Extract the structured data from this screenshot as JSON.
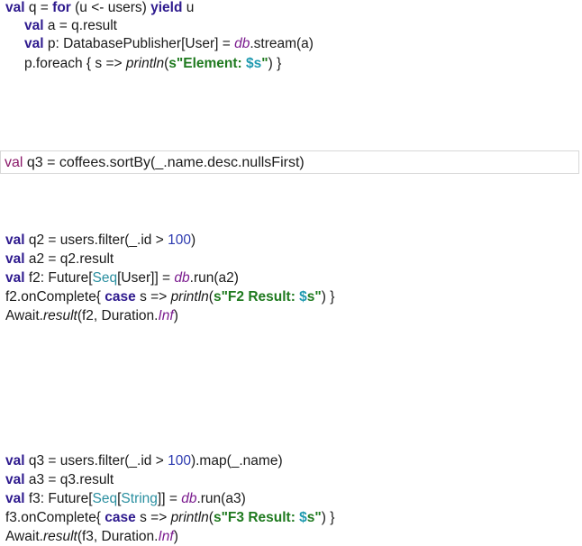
{
  "snippet1": {
    "l1": {
      "a": "val",
      "b": " q = ",
      "c": "for",
      "d": " (u <- users) ",
      "e": "yield",
      "f": " u"
    },
    "l2": {
      "a": "val",
      "b": " a = q.result"
    },
    "l3": {
      "a": "val",
      "b": " p: DatabasePublisher[User] = ",
      "c": "db",
      "d": ".stream(a)"
    },
    "l4": {
      "a": "p.foreach { s => ",
      "b": "println",
      "c": "(",
      "d": "s\"Element: ",
      "e": "$s",
      "f": "\"",
      "g": ") }"
    }
  },
  "snippet2": {
    "l1": {
      "a": "val",
      "b": " q3 = coffees.sortBy(_.name.desc.nullsFirst)"
    }
  },
  "snippet3": {
    "l1": {
      "a": "val",
      "b": " q2 = users.filter(_.id > ",
      "c": "100",
      "d": ")"
    },
    "l2": {
      "a": "val",
      "b": " a2 = q2.result"
    },
    "l3": {
      "a": "val",
      "b": " f2: Future[",
      "c": "Seq",
      "d": "[User]] = ",
      "e": "db",
      "f": ".run(a2)"
    },
    "l4": {
      "a": "f2.onComplete{ ",
      "b": "case",
      "c": " s => ",
      "d": "println",
      "e": "(",
      "f": "s\"F2 Result: ",
      "g": "$",
      "h": "s\"",
      "i": ") }"
    },
    "l5": {
      "a": "Await.",
      "b": "result",
      "c": "(f2, Duration.",
      "d": "Inf",
      "e": ")"
    }
  },
  "snippet4": {
    "l1": {
      "a": "val",
      "b": " q3 = users.filter(_.id > ",
      "c": "100",
      "d": ").map(_.name)"
    },
    "l2": {
      "a": "val",
      "b": " a3 = q3.result"
    },
    "l3": {
      "a": "val",
      "b": " f3: Future[",
      "c": "Seq",
      "d": "[",
      "e": "String",
      "f": "]] = ",
      "g": "db",
      "h": ".run(a3)"
    },
    "l4": {
      "a": "f3.onComplete{ ",
      "b": "case",
      "c": " s => ",
      "d": "println",
      "e": "(",
      "f": "s\"F3 Result: ",
      "g": "$",
      "h": "s\"",
      "i": ") }"
    },
    "l5": {
      "a": "Await.",
      "b": "result",
      "c": "(f3, Duration.",
      "d": "Inf",
      "e": ")"
    }
  }
}
